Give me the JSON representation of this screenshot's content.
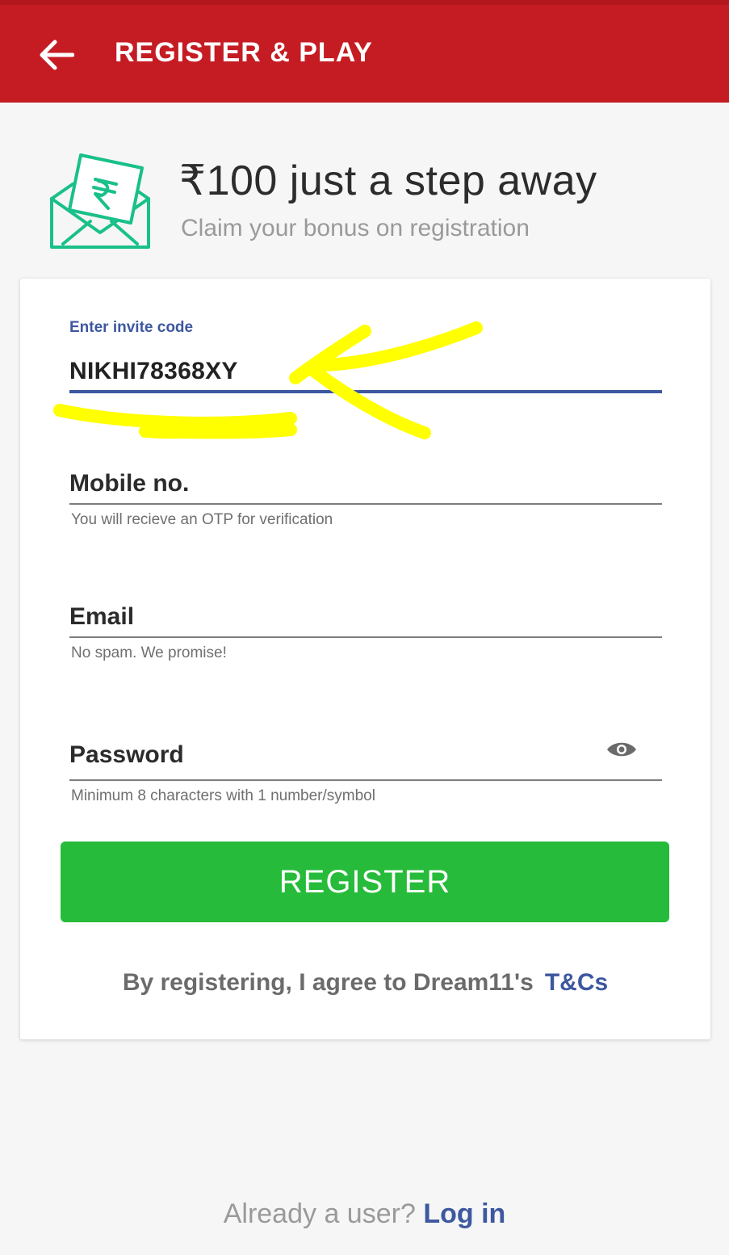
{
  "header": {
    "title": "REGISTER & PLAY"
  },
  "promo": {
    "title": "₹100 just a step away",
    "subtitle": "Claim your bonus on registration",
    "icon": "rupee-envelope-icon"
  },
  "form": {
    "invite": {
      "label": "Enter invite code",
      "value": "NIKHI78368XY"
    },
    "mobile": {
      "placeholder": "Mobile no.",
      "helper": "You will recieve an OTP for verification"
    },
    "email": {
      "placeholder": "Email",
      "helper": "No spam. We promise!"
    },
    "password": {
      "placeholder": "Password",
      "helper": "Minimum 8 characters with 1 number/symbol",
      "toggle_icon": "eye-icon"
    },
    "register_label": "REGISTER",
    "terms_text": "By registering, I agree to Dream11's",
    "terms_link": "T&Cs"
  },
  "footer": {
    "text": "Already a user?",
    "link": "Log in"
  },
  "colors": {
    "header": "#c51c24",
    "accent": "#3d57a0",
    "register": "#26bb3a",
    "icon_green": "#19c08a",
    "annotation": "#ffff00"
  }
}
